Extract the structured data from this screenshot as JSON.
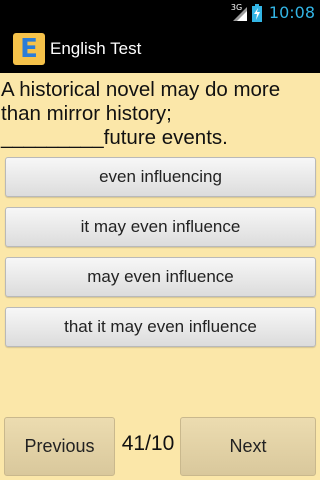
{
  "status_bar": {
    "network_label": "3G",
    "time": "10:08"
  },
  "action_bar": {
    "app_icon_letter": "E",
    "title": "English Test"
  },
  "question": {
    "line1": "A historical novel may do more",
    "line2": "than mirror history;",
    "blank": "_________",
    "line3_rest": "future events."
  },
  "answers": [
    {
      "label": "even influencing"
    },
    {
      "label": "it may even influence"
    },
    {
      "label": "may even influence"
    },
    {
      "label": "that it may even influence"
    }
  ],
  "navigation": {
    "previous_label": "Previous",
    "counter": "41/10",
    "next_label": "Next"
  },
  "colors": {
    "background": "#fbe7a9",
    "clock": "#33b5e5",
    "app_icon_bg": "#f5c24a",
    "app_icon_letter": "#2b7dd8"
  }
}
